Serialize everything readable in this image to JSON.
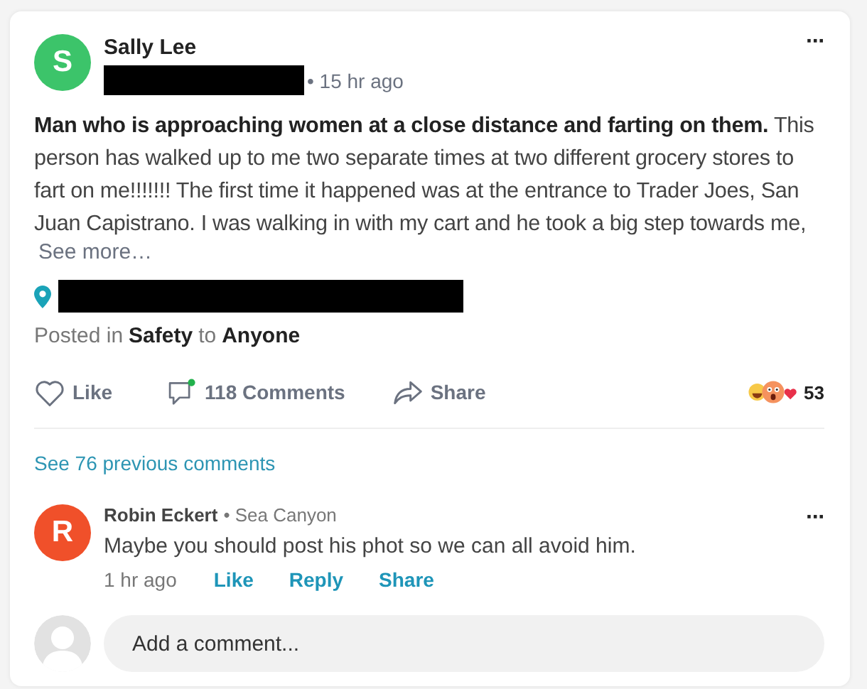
{
  "post": {
    "author": {
      "initial": "S",
      "name": "Sally Lee",
      "color": "#3cc46a"
    },
    "neighborhood_redacted": true,
    "time": "• 15 hr ago",
    "menu": "···",
    "body": "**Man who is approaching women at a close distance and farting on them.** This person has walked up to me two separate times at two different grocery stores to fart on me!!!!!!! The first time it happened was at the entrance to Trader Joes, San Juan Capistrano. I was walking in with my cart and he took a big step towards me,",
    "see_more": "See more…",
    "location_redacted": true,
    "posted_in": {
      "prefix": "Posted in",
      "category": "Safety",
      "joiner": "to",
      "audience": "Anyone"
    },
    "actions": [
      {
        "kind": "like",
        "label": "Like"
      },
      {
        "kind": "comment",
        "label": "118 Comments",
        "unread": true
      },
      {
        "kind": "share",
        "label": "Share"
      }
    ],
    "reaction_count": "53"
  },
  "previous_comments": "See 76 previous comments",
  "comments": [
    {
      "initial": "R",
      "name": "Robin Eckert",
      "color": "#f0502a",
      "place": "• Sea Canyon",
      "menu": "···",
      "text": "Maybe you should post his phot so we can all avoid him.",
      "time": "1 hr ago",
      "actions": [
        "Like",
        "Reply",
        "Share"
      ]
    }
  ],
  "composer": {
    "placeholder": "Add a comment..."
  }
}
